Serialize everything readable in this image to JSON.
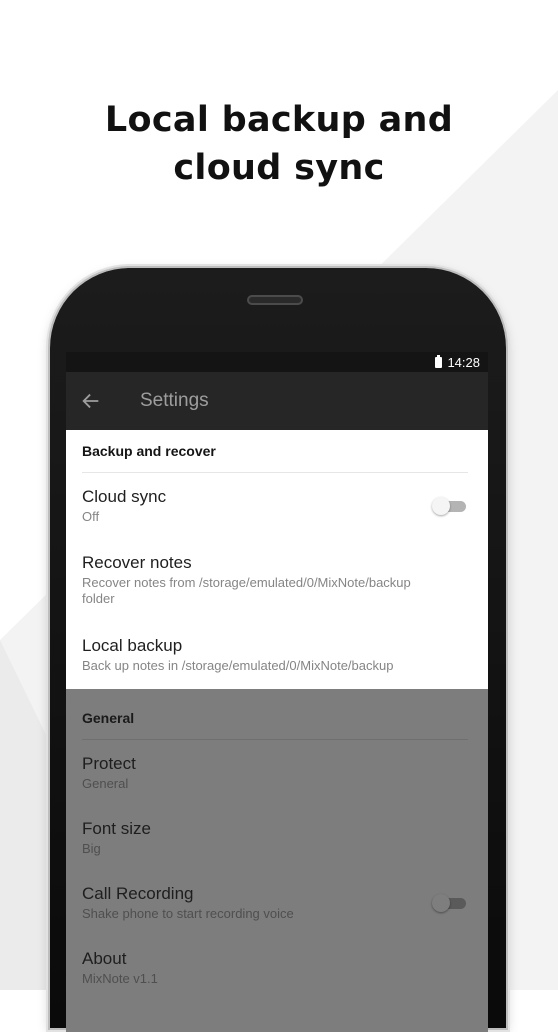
{
  "headline": {
    "line1": "Local backup and",
    "line2": "cloud sync"
  },
  "status_bar": {
    "time": "14:28",
    "battery_icon": "battery-icon"
  },
  "app_bar": {
    "title": "Settings",
    "back_icon": "arrow-left-icon"
  },
  "backup_section": {
    "header": "Backup and recover",
    "items": [
      {
        "title": "Cloud sync",
        "subtitle": "Off",
        "toggle": false
      },
      {
        "title": "Recover notes",
        "subtitle": "Recover notes from /storage/emulated/0/MixNote/backup folder"
      },
      {
        "title": "Local backup",
        "subtitle": "Back up notes in /storage/emulated/0/MixNote/backup"
      }
    ]
  },
  "general_section": {
    "header": "General",
    "items": [
      {
        "title": "Protect",
        "subtitle": "General"
      },
      {
        "title": "Font size",
        "subtitle": "Big"
      },
      {
        "title": "Call Recording",
        "subtitle": "Shake phone to start recording voice",
        "toggle": false
      },
      {
        "title": "About",
        "subtitle": "MixNote v1.1"
      }
    ]
  },
  "colors": {
    "appbar": "#262626",
    "statusbar": "#141414",
    "dim_overlay": "#7d7d7d",
    "card": "#ffffff"
  }
}
